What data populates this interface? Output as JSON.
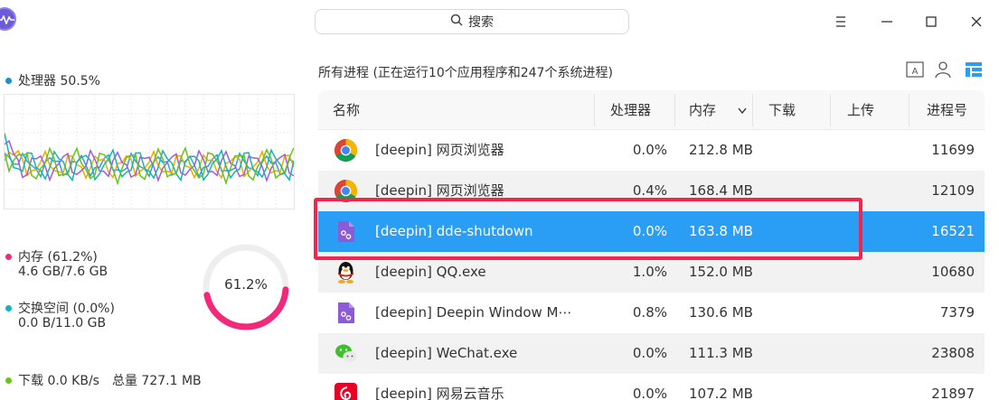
{
  "search": {
    "label": "搜索"
  },
  "window_controls": {
    "menu": "☰",
    "minimize": "—",
    "maximize": "☐",
    "close": "✕"
  },
  "left_panel": {
    "cpu": {
      "label": "处理器 50.5%",
      "color": "#1b8fd0"
    },
    "memory": {
      "label": "内存 (61.2%)",
      "detail": "4.6 GB/7.6 GB",
      "color": "#f2287a",
      "percent": 61.2,
      "ring_text": "61.2%"
    },
    "swap": {
      "label": "交换空间 (0.0%)",
      "detail": "0.0 B/11.0 GB",
      "color": "#13b5b1"
    },
    "network": {
      "download_label": "下载 0.0 KB/s",
      "download_total": "总量 727.1 MB",
      "download_color": "#6bc21a"
    }
  },
  "process_panel": {
    "title": "所有进程 (正在运行10个应用程序和247个系统进程)",
    "columns": {
      "name": "名称",
      "cpu": "处理器",
      "memory": "内存",
      "download": "下载",
      "upload": "上传",
      "pid": "进程号"
    },
    "rows": [
      {
        "name": "[deepin] 网页浏览器",
        "cpu": "0.0%",
        "memory": "212.8 MB",
        "pid": "11699",
        "icon": "chrome-icon"
      },
      {
        "name": "[deepin] 网页浏览器",
        "cpu": "0.4%",
        "memory": "168.4 MB",
        "pid": "12109",
        "icon": "chrome-icon"
      },
      {
        "name": "[deepin] dde-shutdown",
        "cpu": "0.0%",
        "memory": "163.8 MB",
        "pid": "16521",
        "icon": "deepin-app-icon",
        "selected": true
      },
      {
        "name": "[deepin] QQ.exe",
        "cpu": "1.0%",
        "memory": "152.0 MB",
        "pid": "10680",
        "icon": "qq-penguin-icon"
      },
      {
        "name": "[deepin] Deepin Window M⋯",
        "cpu": "0.8%",
        "memory": "130.6 MB",
        "pid": "7379",
        "icon": "deepin-app-icon"
      },
      {
        "name": "[deepin] WeChat.exe",
        "cpu": "0.0%",
        "memory": "111.3 MB",
        "pid": "23808",
        "icon": "wechat-icon"
      },
      {
        "name": "[deepin] 网易云音乐",
        "cpu": "0.0%",
        "memory": "107.2 MB",
        "pid": "21897",
        "icon": "netease-music-icon"
      }
    ]
  },
  "colors": {
    "accent": "#2a9df4",
    "highlight_box": "#f2264d"
  }
}
